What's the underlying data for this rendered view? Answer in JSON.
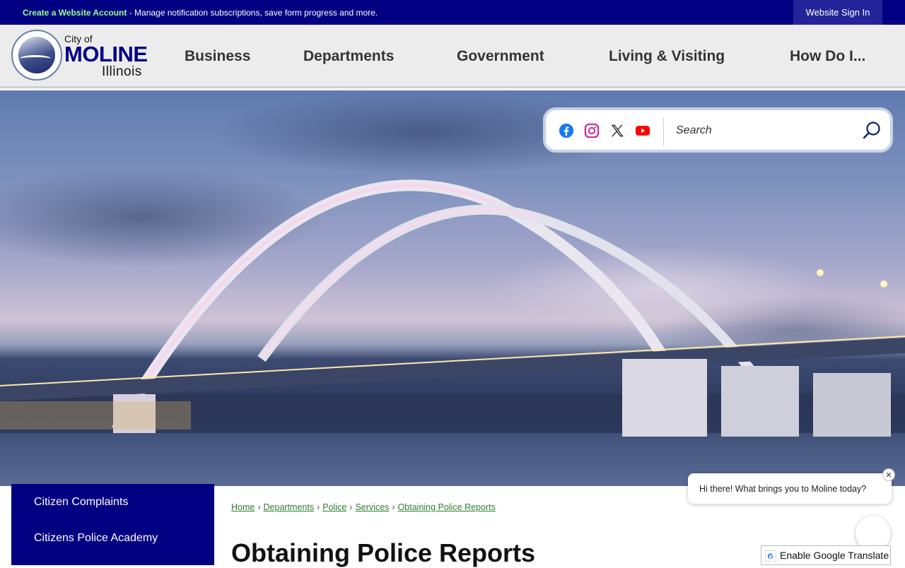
{
  "topbar": {
    "create_link": "Create a Website Account",
    "create_text": " - Manage notification subscriptions, save form progress and more.",
    "signin_label": "Website Sign In"
  },
  "logo": {
    "city_of": "City of",
    "name": "MOLINE",
    "state": "Illinois"
  },
  "nav": {
    "items": [
      {
        "label": "Business"
      },
      {
        "label": "Departments"
      },
      {
        "label": "Government"
      },
      {
        "label": "Living & Visiting"
      },
      {
        "label": "How Do I..."
      }
    ]
  },
  "search": {
    "placeholder": "Search"
  },
  "social": [
    "facebook-icon",
    "instagram-icon",
    "x-icon",
    "youtube-icon"
  ],
  "sidenav": {
    "items": [
      {
        "label": "Citizen Complaints"
      },
      {
        "label": "Citizens Police Academy"
      }
    ]
  },
  "breadcrumb": {
    "items": [
      {
        "label": "Home"
      },
      {
        "label": "Departments"
      },
      {
        "label": "Police"
      },
      {
        "label": "Services"
      },
      {
        "label": "Obtaining Police Reports"
      }
    ],
    "separator": "›"
  },
  "page": {
    "title": "Obtaining Police Reports"
  },
  "chat": {
    "message": "Hi there! What brings you to Moline today?",
    "close": "✕"
  },
  "translate": {
    "label": "Enable Google Translate"
  },
  "colors": {
    "brand_navy": "#010082",
    "link_green": "#2f7d32",
    "create_link_green": "#9bff8a"
  }
}
